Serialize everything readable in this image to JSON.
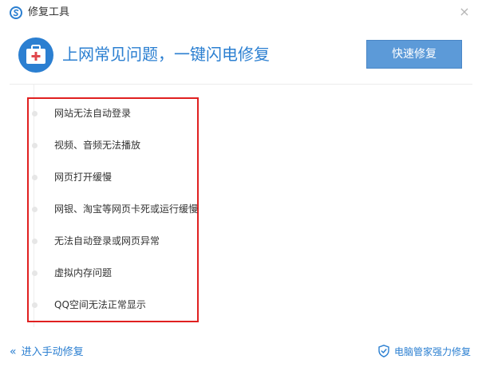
{
  "window": {
    "title": "修复工具",
    "close_glyph": "×"
  },
  "header": {
    "headline": "上网常见问题，一键闪电修复",
    "quick_fix_label": "快速修复",
    "icon": "first-aid-kit-icon",
    "accent_color": "#2b7fd1"
  },
  "issues": [
    {
      "label": "网站无法自动登录"
    },
    {
      "label": "视频、音频无法播放"
    },
    {
      "label": "网页打开缓慢"
    },
    {
      "label": "网银、淘宝等网页卡死或运行缓慢"
    },
    {
      "label": "无法自动登录或网页异常"
    },
    {
      "label": "虚拟内存问题"
    },
    {
      "label": "QQ空间无法正常显示"
    }
  ],
  "footer": {
    "manual_fix_label": "进入手动修复",
    "strong_fix_label": "电脑管家强力修复"
  },
  "colors": {
    "highlight_box": "#e02020",
    "button_bg": "#5c9ad8"
  }
}
